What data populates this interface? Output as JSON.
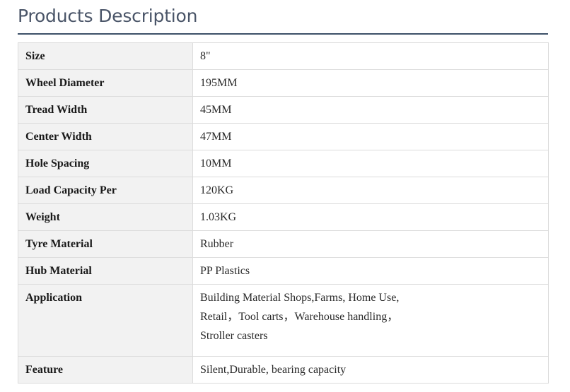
{
  "page": {
    "heading": "Products Description"
  },
  "spec_rows": [
    {
      "label": "Size",
      "value": "8\""
    },
    {
      "label": "Wheel Diameter",
      "value": "195MM"
    },
    {
      "label": "Tread Width",
      "value": "45MM"
    },
    {
      "label": "Center Width",
      "value": "47MM"
    },
    {
      "label": "Hole Spacing",
      "value": "10MM"
    },
    {
      "label": "Load Capacity Per",
      "value": "120KG"
    },
    {
      "label": "Weight",
      "value": "1.03KG"
    },
    {
      "label": "Tyre Material",
      "value": "Rubber"
    },
    {
      "label": "Hub Material",
      "value": "PP Plastics"
    },
    {
      "label": "Application",
      "value_lines": [
        "Building Material Shops,Farms, Home Use,",
        "Retail，Tool carts，Warehouse handling，",
        "Stroller casters"
      ]
    },
    {
      "label": "Feature",
      "value": "Silent,Durable, bearing capacity"
    }
  ]
}
